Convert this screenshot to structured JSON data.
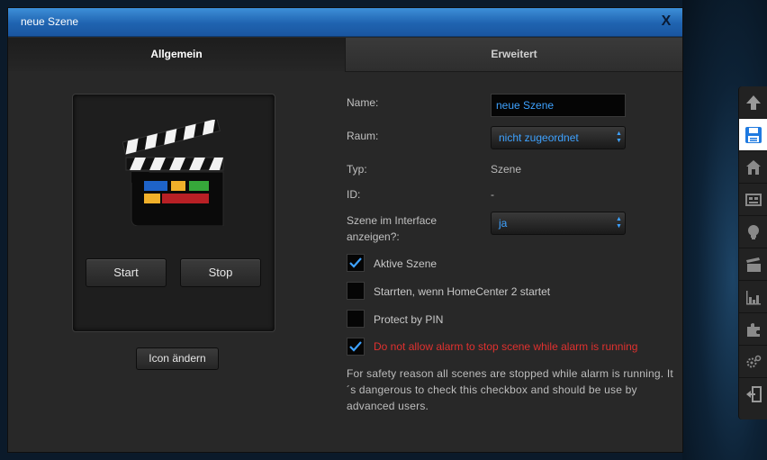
{
  "dialog": {
    "title": "neue Szene",
    "close_label": "X"
  },
  "tabs": [
    {
      "label": "Allgemein",
      "active": true
    },
    {
      "label": "Erweitert",
      "active": false
    }
  ],
  "icon_panel": {
    "icon": "clapperboard-icon",
    "start_label": "Start",
    "stop_label": "Stop",
    "change_icon_label": "Icon ändern"
  },
  "form": {
    "name_label": "Name:",
    "name_value": "neue Szene",
    "room_label": "Raum:",
    "room_value": "nicht zugeordnet",
    "type_label": "Typ:",
    "type_value": "Szene",
    "id_label": "ID:",
    "id_value": "-",
    "show_label_line1": "Szene im Interface",
    "show_label_line2": "anzeigen?:",
    "show_value": "ja"
  },
  "checkboxes": [
    {
      "label": "Aktive Szene",
      "checked": true
    },
    {
      "label": "Starrten, wenn HomeCenter 2 startet",
      "checked": false
    },
    {
      "label": "Protect by PIN",
      "checked": false
    },
    {
      "label": "Do not allow alarm to stop scene while alarm is running",
      "checked": true
    }
  ],
  "note": "For safety reason all scenes are stopped while alarm is running. It´s dangerous to check this checkbox and should be use by advanced users.",
  "toolbar": {
    "items": [
      "arrow-up-icon",
      "save-icon",
      "home-icon",
      "device-icon",
      "lightbulb-icon",
      "clapperboard-icon",
      "chart-icon",
      "plugin-icon",
      "settings-icon",
      "logout-icon"
    ],
    "active_item": "save-icon"
  },
  "colors": {
    "titlebar": "#1f63b0",
    "accent_blue": "#3ea2ff",
    "warning_red": "#e0312f",
    "dialog_bg": "#282828"
  }
}
